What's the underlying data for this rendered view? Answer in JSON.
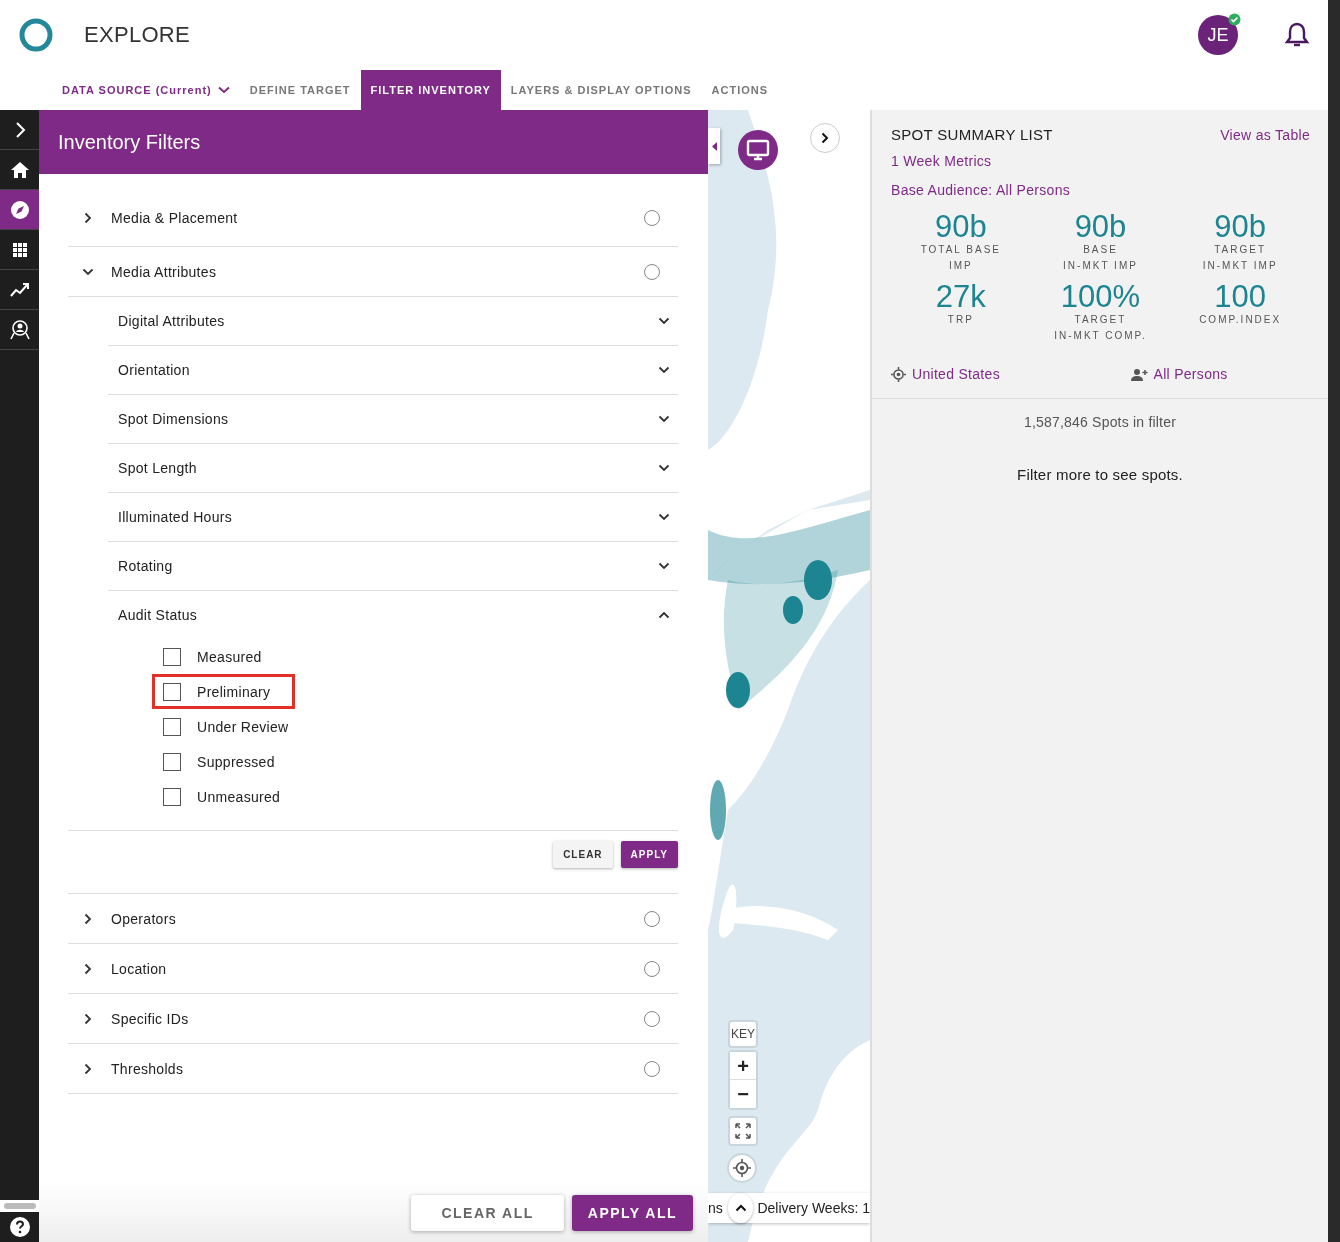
{
  "app": {
    "title": "EXPLORE",
    "avatar": {
      "initials": "JE",
      "verified": true
    }
  },
  "tabs": [
    {
      "label": "DATA SOURCE (Current)",
      "kind": "dropdown",
      "selected": false
    },
    {
      "label": "DEFINE TARGET",
      "kind": "tab",
      "selected": false
    },
    {
      "label": "FILTER INVENTORY",
      "kind": "tab",
      "selected": true
    },
    {
      "label": "LAYERS & DISPLAY OPTIONS",
      "kind": "tab",
      "selected": false
    },
    {
      "label": "ACTIONS",
      "kind": "tab",
      "selected": false
    }
  ],
  "rail": [
    {
      "kind": "expand",
      "selected": false
    },
    {
      "kind": "home",
      "selected": false
    },
    {
      "kind": "explore",
      "selected": true
    },
    {
      "kind": "apps",
      "selected": false
    },
    {
      "kind": "trend",
      "selected": false
    },
    {
      "kind": "audience",
      "selected": false
    }
  ],
  "filter_panel": {
    "title": "Inventory Filters",
    "sections": [
      {
        "label": "Media & Placement",
        "expanded": false,
        "applied": false
      },
      {
        "label": "Media Attributes",
        "expanded": true,
        "applied": false,
        "children": [
          {
            "label": "Digital Attributes",
            "expanded": false
          },
          {
            "label": "Orientation",
            "expanded": false
          },
          {
            "label": "Spot Dimensions",
            "expanded": false
          },
          {
            "label": "Spot Length",
            "expanded": false
          },
          {
            "label": "Illuminated Hours",
            "expanded": false
          },
          {
            "label": "Rotating",
            "expanded": false
          },
          {
            "label": "Audit Status",
            "expanded": true,
            "options": [
              {
                "label": "Measured",
                "checked": false,
                "highlighted": false
              },
              {
                "label": "Preliminary",
                "checked": false,
                "highlighted": true
              },
              {
                "label": "Under Review",
                "checked": false,
                "highlighted": false
              },
              {
                "label": "Suppressed",
                "checked": false,
                "highlighted": false
              },
              {
                "label": "Unmeasured",
                "checked": false,
                "highlighted": false
              }
            ],
            "buttons": [
              "CLEAR",
              "APPLY"
            ]
          }
        ]
      },
      {
        "label": "Operators",
        "expanded": false,
        "applied": false
      },
      {
        "label": "Location",
        "expanded": false,
        "applied": false
      },
      {
        "label": "Specific IDs",
        "expanded": false,
        "applied": false
      },
      {
        "label": "Thresholds",
        "expanded": false,
        "applied": false
      }
    ],
    "footer_buttons": [
      "CLEAR ALL",
      "APPLY ALL"
    ]
  },
  "map": {
    "kind": "picture",
    "key_button": "KEY",
    "zoom_in": "+",
    "zoom_out": "−",
    "bottom_bar": {
      "left_text": "ns",
      "right_text": "Delivery Weeks: 1"
    }
  },
  "summary": {
    "title": "SPOT SUMMARY LIST",
    "table_link": "View as Table",
    "period": "1 Week Metrics",
    "audience": "Base Audience: All Persons",
    "metrics": [
      {
        "value": "90b",
        "label": "TOTAL BASE\nIMP"
      },
      {
        "value": "90b",
        "label": "BASE\nIN-MKT IMP"
      },
      {
        "value": "90b",
        "label": "TARGET\nIN-MKT IMP"
      },
      {
        "value": "27k",
        "label": "TRP"
      },
      {
        "value": "100%",
        "label": "TARGET\nIN-MKT COMP."
      },
      {
        "value": "100",
        "label": "COMP.INDEX"
      }
    ],
    "location": "United States",
    "persons": "All Persons",
    "spot_count": "1,587,846 Spots in filter",
    "message": "Filter more to see spots."
  }
}
